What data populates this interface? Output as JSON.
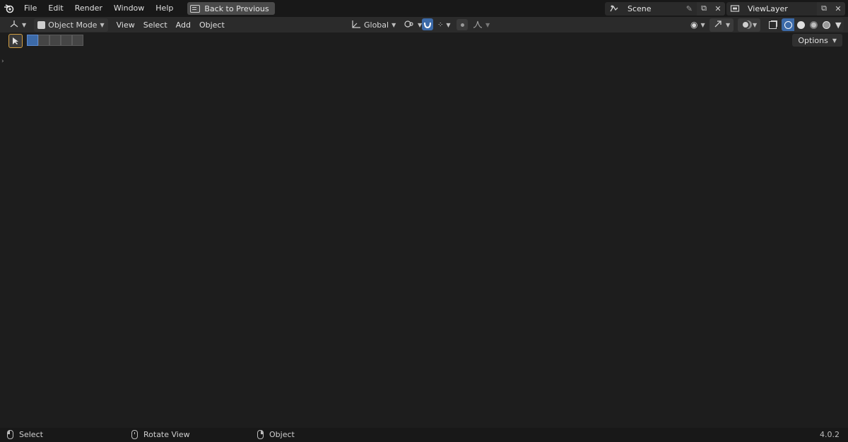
{
  "menu": {
    "items": [
      "File",
      "Edit",
      "Render",
      "Window",
      "Help"
    ],
    "back_button": "Back to Previous"
  },
  "scene": {
    "name": "Scene"
  },
  "view_layer": {
    "name": "ViewLayer"
  },
  "viewport_header": {
    "mode": "Object Mode",
    "menus": [
      "View",
      "Select",
      "Add",
      "Object"
    ],
    "transform_orientation": "Global"
  },
  "toolbar": {
    "options_label": "Options"
  },
  "status": {
    "left_mouse": "Select",
    "middle_mouse": "Rotate View",
    "right_mouse": "Object",
    "version": "4.0.2"
  },
  "icons": {
    "logo": "blender-logo-icon",
    "viewport_shading_active": "wireframe-icon"
  },
  "colors": {
    "selection_accent": "#d4a043",
    "active_blue": "#3c6aa8"
  }
}
